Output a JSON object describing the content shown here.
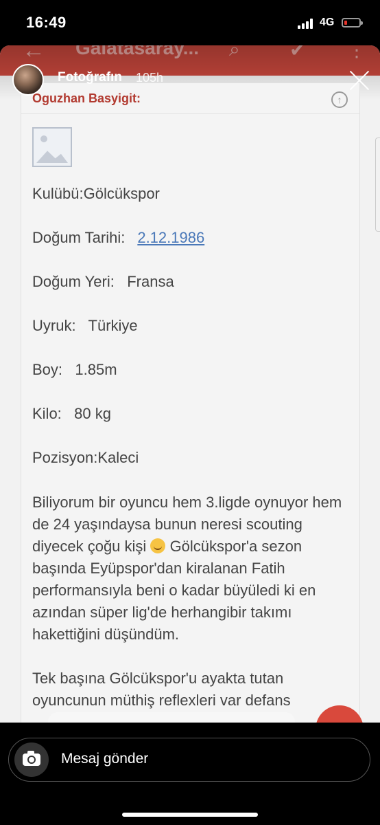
{
  "status_bar": {
    "time": "16:49",
    "network": "4G",
    "battery_level": 0.15
  },
  "app": {
    "title": "Galatasaray...",
    "back_icon": "arrow-left-icon",
    "icons": [
      "search-icon",
      "check-circle-icon",
      "more-vert-icon"
    ]
  },
  "story": {
    "username": "Fotoğrafın",
    "time_ago": "105h"
  },
  "post": {
    "author": "Oguzhan Basyigit:",
    "club_label": "Kulübü:Gölcükspor",
    "birth_label": "Doğum Tarihi:",
    "birth_date": "2.12.1986",
    "birthplace_label": "Doğum Yeri:",
    "birthplace": "Fransa",
    "nationality_label": "Uyruk:",
    "nationality": "Türkiye",
    "height_label": "Boy:",
    "height": "1.85m",
    "weight_label": "Kilo:",
    "weight": "80 kg",
    "position_label": "Pozisyon:Kaleci",
    "paragraph1": "Biliyorum bir oyuncu hem 3.ligde oynuyor hem de 24 yaşındaysa bunun neresi scouting diyecek çoğu kişi",
    "paragraph1_rest": "Gölcükspor'a sezon başında Eyüpspor'dan kiralanan Fatih performansıyla beni o kadar büyüledi ki en azından süper lig'de herhangibir takımı hakettiğini düşündüm.",
    "paragraph2": "Tek başına Gölcükspor'u ayakta tutan oyuncunun müthiş reflexleri var defans"
  },
  "message": {
    "placeholder": "Mesaj gönder"
  }
}
